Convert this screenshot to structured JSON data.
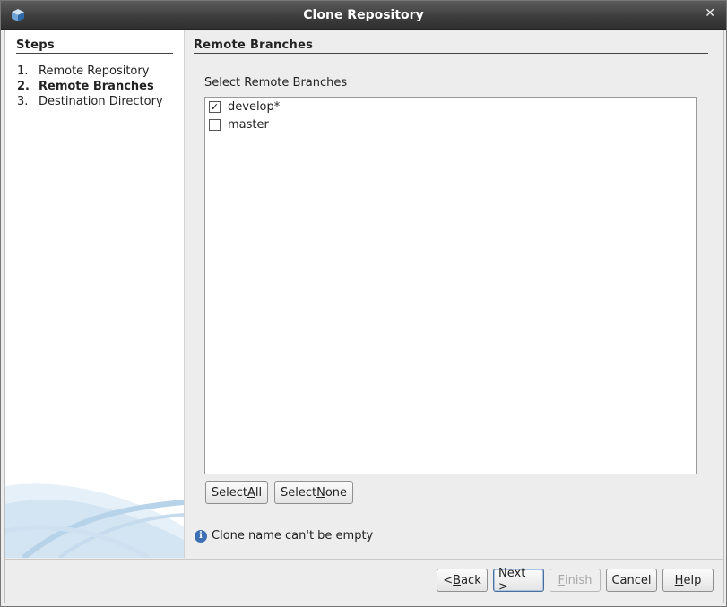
{
  "window": {
    "title": "Clone Repository"
  },
  "steps": {
    "title": "Steps",
    "items": [
      {
        "num": "1.",
        "label": "Remote Repository"
      },
      {
        "num": "2.",
        "label": "Remote Branches"
      },
      {
        "num": "3.",
        "label": "Destination Directory"
      }
    ]
  },
  "content": {
    "title": "Remote Branches",
    "list_label": "Select Remote Branches",
    "branches": [
      {
        "name": "develop*",
        "checked": true
      },
      {
        "name": "master",
        "checked": false
      }
    ]
  },
  "buttons": {
    "select_all": {
      "pre": "Select ",
      "mnemonic": "A",
      "post": "ll"
    },
    "select_none": {
      "pre": "Select ",
      "mnemonic": "N",
      "post": "one"
    },
    "back": {
      "pre": "< ",
      "mnemonic": "B",
      "post": "ack"
    },
    "next": "Next >",
    "finish": {
      "mnemonic": "F",
      "post": "inish"
    },
    "cancel": "Cancel",
    "help": {
      "mnemonic": "H",
      "post": "elp"
    }
  },
  "info": {
    "message": "Clone name can't be empty"
  },
  "icons": {
    "app": "netbeans-cube-icon",
    "close": "close-icon",
    "info": "info-icon",
    "check": "✓"
  },
  "colors": {
    "titlebar": "#3e3e3e",
    "info_icon": "#3d6fb3",
    "focus": "#4a6f9a"
  }
}
